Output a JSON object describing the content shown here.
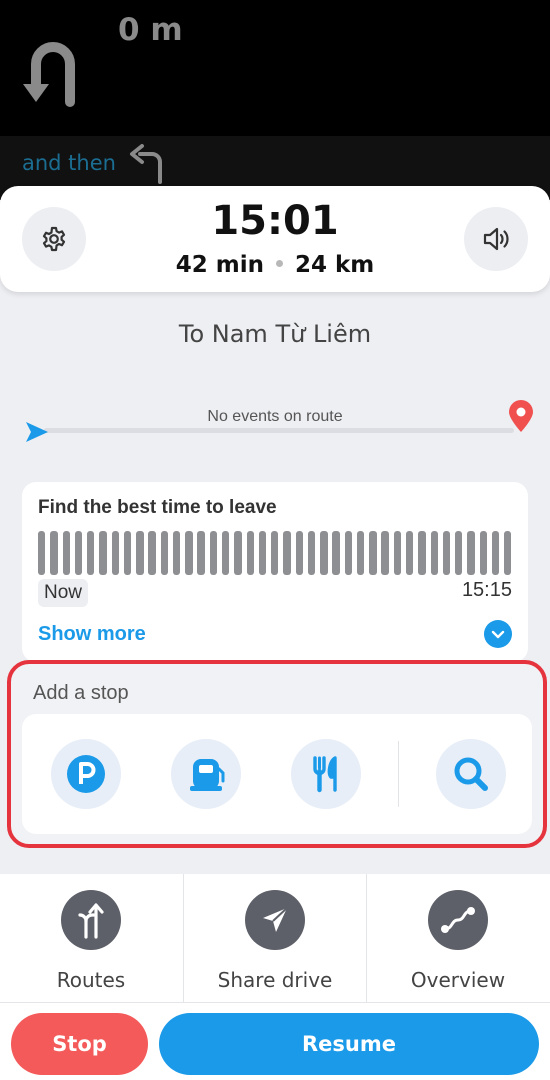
{
  "nav": {
    "distance": "0 m",
    "then_label": "and then",
    "current_maneuver_icon": "u-turn-icon",
    "next_maneuver_icon": "turn-left-icon"
  },
  "eta": {
    "arrival_time": "15:01",
    "duration": "42 min",
    "distance": "24 km"
  },
  "destination": "To Nam Từ Liêm",
  "route": {
    "events_text": "No events on route"
  },
  "best_time": {
    "title": "Find the best time to leave",
    "start_label": "Now",
    "end_label": "15:15",
    "show_more_label": "Show more",
    "bar_count": 39
  },
  "add_stop": {
    "title": "Add a stop",
    "options": [
      "parking-icon",
      "gas-station-icon",
      "restaurant-icon",
      "search-icon"
    ]
  },
  "actions": {
    "routes_label": "Routes",
    "share_label": "Share drive",
    "overview_label": "Overview"
  },
  "buttons": {
    "stop_label": "Stop",
    "resume_label": "Resume"
  },
  "colors": {
    "accent_blue": "#1a9ae8",
    "stop_red": "#f45a5a",
    "highlight_red": "#e5343d",
    "icon_gray": "#5d6068"
  }
}
